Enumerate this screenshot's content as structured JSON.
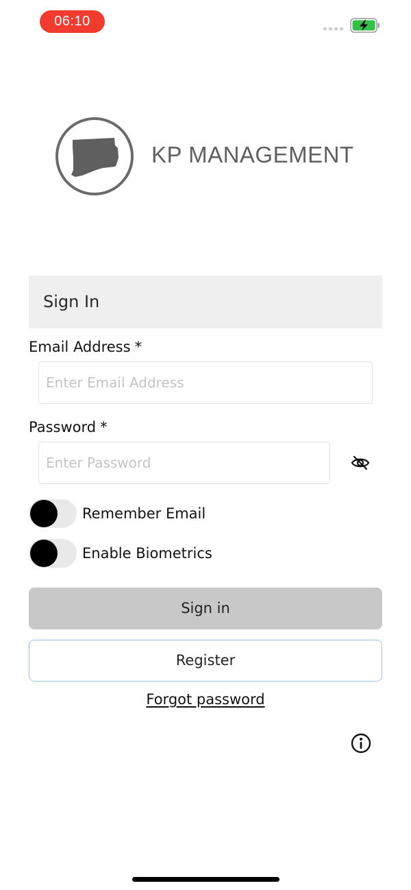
{
  "status_bar": {
    "time": "06:10",
    "time_badge_color": "#f23b2f",
    "battery_state": "charging",
    "battery_color": "#32c145"
  },
  "brand": {
    "name": "KP MANAGEMENT",
    "logo_icon": "connecticut-state-map-circle-icon",
    "logo_color": "#5f5f5f"
  },
  "form": {
    "header": "Sign In",
    "email": {
      "label": "Email Address",
      "required_mark": "*",
      "placeholder": "Enter Email Address",
      "value": ""
    },
    "password": {
      "label": "Password",
      "required_mark": "*",
      "placeholder": "Enter Password",
      "value": "",
      "visibility_icon": "eye-slash-icon"
    },
    "toggles": [
      {
        "label": "Remember Email",
        "checked": false
      },
      {
        "label": "Enable Biometrics",
        "checked": false
      }
    ],
    "signin_button": "Sign in",
    "register_button": "Register",
    "forgot_link": "Forgot password",
    "info_icon": "info-circle-icon"
  }
}
